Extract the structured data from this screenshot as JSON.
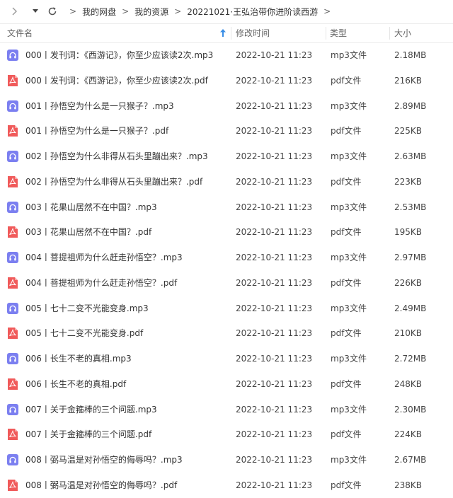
{
  "breadcrumb": [
    "我的网盘",
    "我的资源",
    "20221021·王弘治带你进阶读西游"
  ],
  "columns": {
    "name": "文件名",
    "date": "修改时间",
    "type": "类型",
    "size": "大小"
  },
  "colors": {
    "mp3_icon": "#7b7ff0",
    "pdf_icon": "#f05a5a",
    "sort_arrow": "#3a8ee6"
  },
  "files": [
    {
      "name": "000丨发刊词：《西游记》，你至少应该读2次.mp3",
      "date": "2022-10-21 11:23",
      "type": "mp3文件",
      "size": "2.18MB",
      "icon": "audio-icon"
    },
    {
      "name": "000丨发刊词：《西游记》，你至少应该读2次.pdf",
      "date": "2022-10-21 11:23",
      "type": "pdf文件",
      "size": "216KB",
      "icon": "pdf-icon"
    },
    {
      "name": "001丨孙悟空为什么是一只猴子？.mp3",
      "date": "2022-10-21 11:23",
      "type": "mp3文件",
      "size": "2.89MB",
      "icon": "audio-icon"
    },
    {
      "name": "001丨孙悟空为什么是一只猴子？.pdf",
      "date": "2022-10-21 11:23",
      "type": "pdf文件",
      "size": "225KB",
      "icon": "pdf-icon"
    },
    {
      "name": "002丨孙悟空为什么非得从石头里蹦出来？.mp3",
      "date": "2022-10-21 11:23",
      "type": "mp3文件",
      "size": "2.63MB",
      "icon": "audio-icon"
    },
    {
      "name": "002丨孙悟空为什么非得从石头里蹦出来？.pdf",
      "date": "2022-10-21 11:23",
      "type": "pdf文件",
      "size": "223KB",
      "icon": "pdf-icon"
    },
    {
      "name": "003丨花果山居然不在中国？.mp3",
      "date": "2022-10-21 11:23",
      "type": "mp3文件",
      "size": "2.53MB",
      "icon": "audio-icon"
    },
    {
      "name": "003丨花果山居然不在中国？.pdf",
      "date": "2022-10-21 11:23",
      "type": "pdf文件",
      "size": "195KB",
      "icon": "pdf-icon"
    },
    {
      "name": "004丨菩提祖师为什么赶走孙悟空？.mp3",
      "date": "2022-10-21 11:23",
      "type": "mp3文件",
      "size": "2.97MB",
      "icon": "audio-icon"
    },
    {
      "name": "004丨菩提祖师为什么赶走孙悟空？.pdf",
      "date": "2022-10-21 11:23",
      "type": "pdf文件",
      "size": "226KB",
      "icon": "pdf-icon"
    },
    {
      "name": "005丨七十二变不光能变身.mp3",
      "date": "2022-10-21 11:23",
      "type": "mp3文件",
      "size": "2.49MB",
      "icon": "audio-icon"
    },
    {
      "name": "005丨七十二变不光能变身.pdf",
      "date": "2022-10-21 11:23",
      "type": "pdf文件",
      "size": "210KB",
      "icon": "pdf-icon"
    },
    {
      "name": "006丨长生不老的真相.mp3",
      "date": "2022-10-21 11:23",
      "type": "mp3文件",
      "size": "2.72MB",
      "icon": "audio-icon"
    },
    {
      "name": "006丨长生不老的真相.pdf",
      "date": "2022-10-21 11:23",
      "type": "pdf文件",
      "size": "248KB",
      "icon": "pdf-icon"
    },
    {
      "name": "007丨关于金箍棒的三个问题.mp3",
      "date": "2022-10-21 11:23",
      "type": "mp3文件",
      "size": "2.30MB",
      "icon": "audio-icon"
    },
    {
      "name": "007丨关于金箍棒的三个问题.pdf",
      "date": "2022-10-21 11:23",
      "type": "pdf文件",
      "size": "224KB",
      "icon": "pdf-icon"
    },
    {
      "name": "008丨弼马温是对孙悟空的侮辱吗？.mp3",
      "date": "2022-10-21 11:23",
      "type": "mp3文件",
      "size": "2.67MB",
      "icon": "audio-icon"
    },
    {
      "name": "008丨弼马温是对孙悟空的侮辱吗？.pdf",
      "date": "2022-10-21 11:23",
      "type": "pdf文件",
      "size": "238KB",
      "icon": "pdf-icon"
    }
  ]
}
